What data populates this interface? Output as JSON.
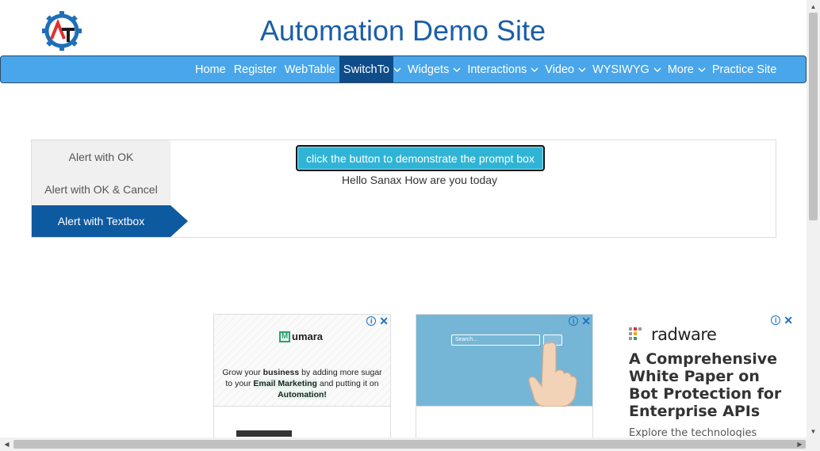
{
  "site": {
    "title": "Automation Demo Site",
    "logo_letters": "AT",
    "brand_color": "#1b5ea8"
  },
  "nav": {
    "items": [
      {
        "label": "Home",
        "dropdown": false,
        "active": false
      },
      {
        "label": "Register",
        "dropdown": false,
        "active": false
      },
      {
        "label": "WebTable",
        "dropdown": false,
        "active": false
      },
      {
        "label": "SwitchTo",
        "dropdown": true,
        "active": true
      },
      {
        "label": "Widgets",
        "dropdown": true,
        "active": false
      },
      {
        "label": "Interactions",
        "dropdown": true,
        "active": false
      },
      {
        "label": "Video",
        "dropdown": true,
        "active": false
      },
      {
        "label": "WYSIWYG",
        "dropdown": true,
        "active": false
      },
      {
        "label": "More",
        "dropdown": true,
        "active": false
      },
      {
        "label": "Practice Site",
        "dropdown": false,
        "active": false
      }
    ],
    "bg_color": "#4aa6ea",
    "active_color": "#0e4d8a"
  },
  "alerts": {
    "tabs": [
      {
        "label": "Alert with OK",
        "active": false
      },
      {
        "label": "Alert with OK & Cancel",
        "active": false
      },
      {
        "label": "Alert with Textbox",
        "active": true
      }
    ],
    "button_label": "click the button to demonstrate the prompt box",
    "result_text": "Hello Sanax How are you today"
  },
  "ads": {
    "ad1": {
      "brand": "umara",
      "brand_initial": "M",
      "copy_1": "Grow your ",
      "copy_2": "business",
      "copy_3": " by adding more sugar to your ",
      "copy_4": "Email Marketing",
      "copy_5": " and putting it on ",
      "copy_6": "Automation!"
    },
    "ad2": {
      "search_placeholder": "Search..."
    },
    "ad3": {
      "brand": "radware",
      "headline": "A Comprehensive White Paper on Bot Protection for Enterprise APIs",
      "sub": "Explore the technologies"
    },
    "info_icon": "i",
    "close_icon": "✕"
  }
}
